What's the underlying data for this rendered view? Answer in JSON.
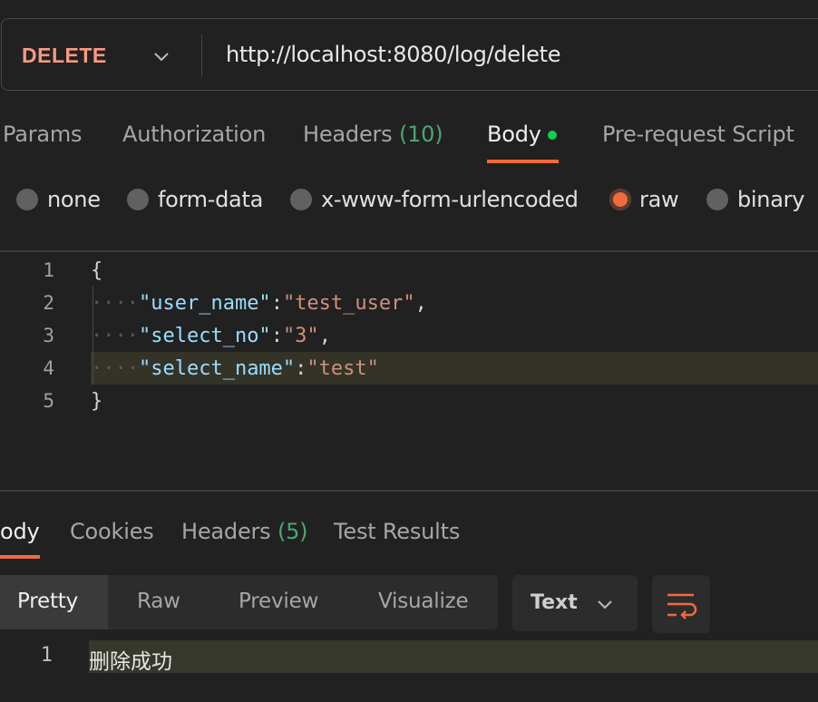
{
  "request": {
    "method": "DELETE",
    "url": "http://localhost:8080/log/delete"
  },
  "request_tabs": [
    {
      "label": "Params"
    },
    {
      "label": "Authorization"
    },
    {
      "label": "Headers",
      "count": "(10)"
    },
    {
      "label": "Body",
      "active": true
    },
    {
      "label": "Pre-request Script"
    }
  ],
  "body_types": [
    {
      "label": "none"
    },
    {
      "label": "form-data"
    },
    {
      "label": "x-www-form-urlencoded"
    },
    {
      "label": "raw",
      "selected": true
    },
    {
      "label": "binary"
    }
  ],
  "editor": {
    "line_numbers": [
      "1",
      "2",
      "3",
      "4",
      "5"
    ],
    "lines": {
      "l1": "{",
      "l2_key": "\"user_name\"",
      "l2_val": "\"test_user\"",
      "l3_key": "\"select_no\"",
      "l3_val": "\"3\"",
      "l4_key": "\"select_name\"",
      "l4_val": "\"test\"",
      "l5": "}"
    },
    "highlighted_line": 4
  },
  "response_tabs": [
    {
      "label": "ody",
      "active": true
    },
    {
      "label": "Cookies"
    },
    {
      "label": "Headers",
      "count": "(5)"
    },
    {
      "label": "Test Results"
    }
  ],
  "format_tabs": [
    {
      "label": "Pretty",
      "active": true
    },
    {
      "label": "Raw"
    },
    {
      "label": "Preview"
    },
    {
      "label": "Visualize"
    }
  ],
  "format_type": "Text",
  "response": {
    "line_number": "1",
    "text": "删除成功"
  },
  "colors": {
    "accent": "#f26b3a",
    "method": "#f79a83",
    "count_green": "#49a86f",
    "dot_green": "#0fcf50",
    "json_key": "#9cdcfe",
    "json_string": "#ce9178"
  },
  "icons": {
    "method_dropdown": "chevron-down-icon",
    "format_dropdown": "chevron-down-icon",
    "wrap": "text-wrap-icon"
  }
}
